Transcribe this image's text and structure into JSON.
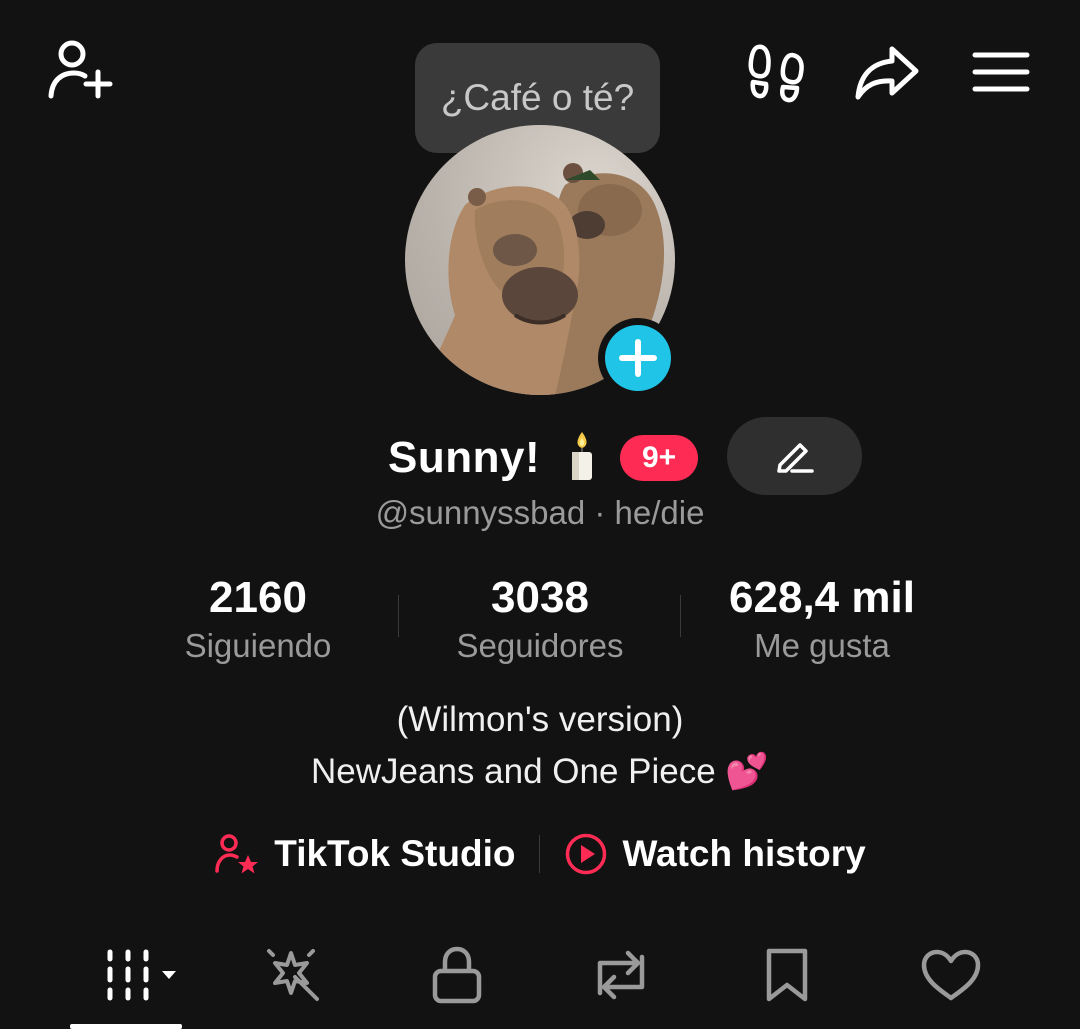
{
  "header": {
    "add_friend_icon": "person-add-icon",
    "activity_icon": "footprints-icon",
    "share_icon": "share-arrow-icon",
    "menu_icon": "hamburger-menu-icon"
  },
  "note": {
    "text": "¿Café o té?"
  },
  "profile": {
    "display_name": "Sunny!",
    "name_emoji": "🕯️",
    "notification_badge": "9+",
    "handle_line": "@sunnyssbad · he/die",
    "accent_color": "#fe2c55",
    "add_button_color": "#20c4e6"
  },
  "stats": [
    {
      "value": "2160",
      "label": "Siguiendo"
    },
    {
      "value": "3038",
      "label": "Seguidores"
    },
    {
      "value": "628,4 mil",
      "label": "Me gusta"
    }
  ],
  "bio": {
    "line1": "(Wilmon's version)",
    "line2": "NewJeans and One Piece 💕"
  },
  "links": {
    "studio": "TikTok Studio",
    "history": "Watch history"
  },
  "tabs": [
    {
      "icon": "grid-videos-icon",
      "active": true
    },
    {
      "icon": "magic-wand-icon"
    },
    {
      "icon": "lock-icon"
    },
    {
      "icon": "repost-icon"
    },
    {
      "icon": "bookmark-icon"
    },
    {
      "icon": "heart-icon"
    }
  ]
}
